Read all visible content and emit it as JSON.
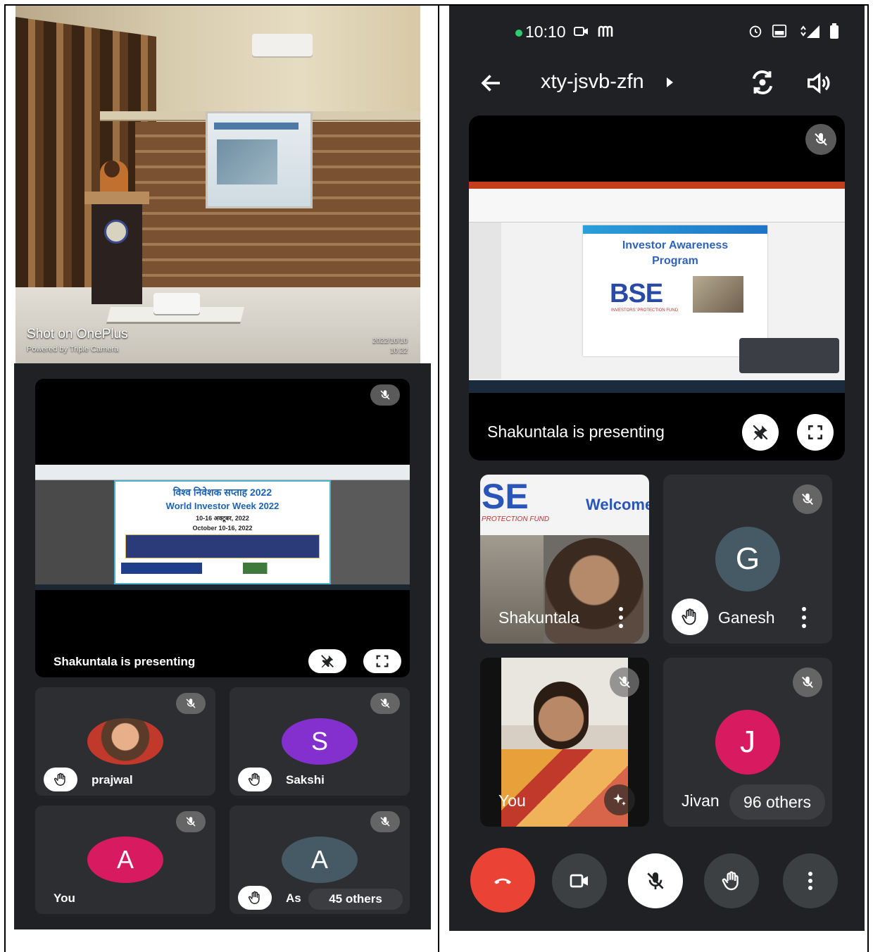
{
  "photo": {
    "shot_label": "Shot on OnePlus",
    "shot_sub": "Powered by Triple Camera",
    "date": "2022/10/10",
    "time": "10:22"
  },
  "left_meet": {
    "slide": {
      "title_hi": "विश्व निवेशक सप्ताह 2022",
      "title_en": "World Investor Week 2022",
      "date_hi": "10-16 अक्टूबर, 2022",
      "date_en": "October 10-16, 2022"
    },
    "presenting": "Shakuntala is presenting",
    "participants": [
      {
        "name": "prajwal",
        "initial": "",
        "hand": true
      },
      {
        "name": "Sakshi",
        "initial": "S",
        "hand": true,
        "color": "#8430ce"
      },
      {
        "name": "You",
        "initial": "A",
        "hand": false,
        "color": "#d81b60"
      },
      {
        "name": "As",
        "initial": "A",
        "hand": true,
        "color": "#455a64"
      }
    ],
    "others": "45 others"
  },
  "phone": {
    "status_time": "10:10",
    "meeting_code": "xty-jsvb-zfn",
    "slide": {
      "title1": "Investor Awareness",
      "title2": "Program",
      "logo": "BSE",
      "logo_sub": "INVESTORS' PROTECTION FUND"
    },
    "presenting": "Shakuntala is presenting",
    "tiles": [
      {
        "name": "Shakuntala",
        "banner_left": "SE",
        "banner_right": "Welcome",
        "banner_sub": "PROTECTION FUND"
      },
      {
        "name": "Ganesh",
        "initial": "G",
        "color": "#455a64"
      },
      {
        "name": "You"
      },
      {
        "name": "Jivan",
        "initial": "J",
        "color": "#d81b60"
      }
    ],
    "others": "96 others"
  },
  "colors": {
    "meet_bg": "#202124",
    "tile_bg": "#2d2e31",
    "end_call": "#ea4335"
  }
}
